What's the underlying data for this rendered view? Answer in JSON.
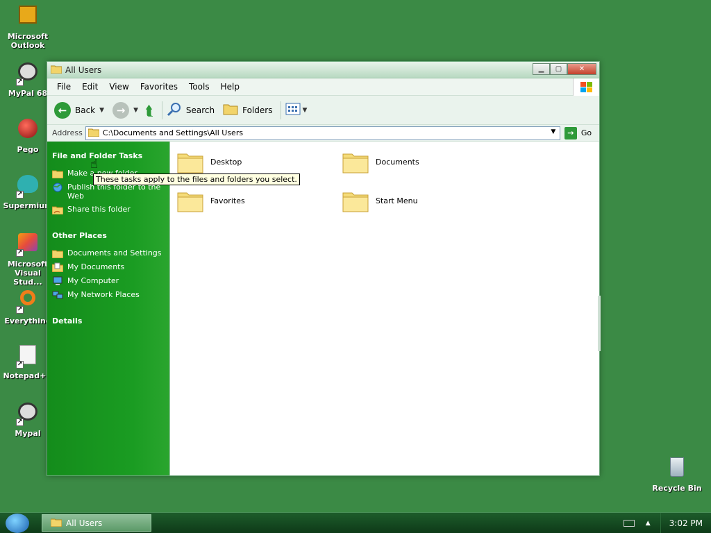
{
  "desktop": {
    "icons": [
      {
        "label": "Microsoft Outlook"
      },
      {
        "label": "MyPal 68"
      },
      {
        "label": "Pego"
      },
      {
        "label": "Supermium"
      },
      {
        "label": "Microsoft Visual Stud..."
      },
      {
        "label": "Everything"
      },
      {
        "label": "Notepad++"
      },
      {
        "label": "Mypal"
      },
      {
        "label": "Recycle Bin"
      }
    ]
  },
  "window": {
    "title": "All Users",
    "menu": [
      "File",
      "Edit",
      "View",
      "Favorites",
      "Tools",
      "Help"
    ],
    "toolbar": {
      "back": "Back",
      "search": "Search",
      "folders": "Folders"
    },
    "address": {
      "label": "Address",
      "value": "C:\\Documents and Settings\\All Users",
      "go": "Go"
    },
    "taskpane": {
      "file_tasks_title": "File and Folder Tasks",
      "file_tasks": [
        "Make a new folder",
        "Publish this folder to the Web",
        "Share this folder"
      ],
      "other_places_title": "Other Places",
      "other_places": [
        "Documents and Settings",
        "My Documents",
        "My Computer",
        "My Network Places"
      ],
      "details_title": "Details"
    },
    "files": [
      "Desktop",
      "Documents",
      "Favorites",
      "Start Menu"
    ],
    "tooltip": "These tasks apply to the files and folders you select."
  },
  "taskbar": {
    "item": "All Users",
    "clock": "3:02 PM"
  }
}
